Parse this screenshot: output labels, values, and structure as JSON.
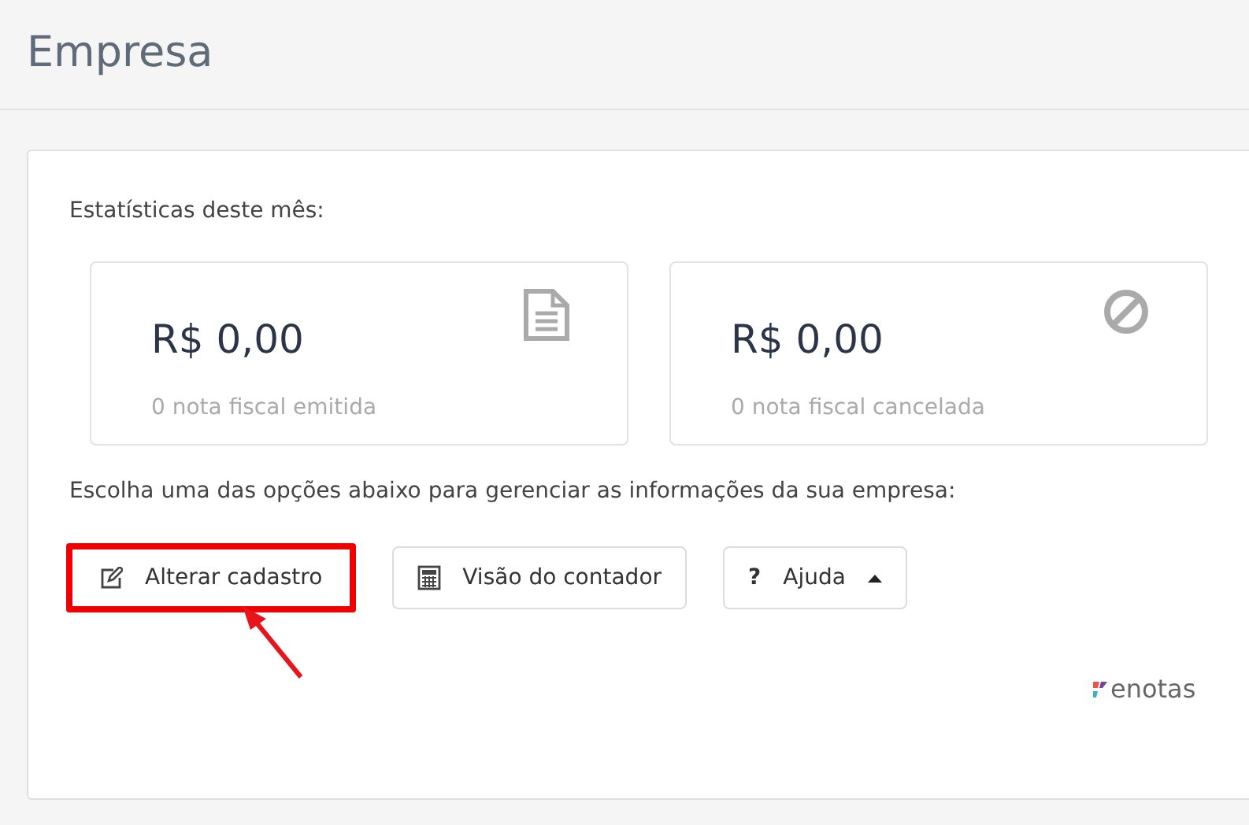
{
  "page": {
    "title": "Empresa"
  },
  "stats_label": "Estatísticas deste mês:",
  "stats": [
    {
      "kind": "document",
      "amount": "R$ 0,00",
      "caption": "0 nota fiscal emitida"
    },
    {
      "kind": "ban",
      "amount": "R$ 0,00",
      "caption": "0 nota fiscal cancelada"
    }
  ],
  "options_label": "Escolha uma das opções abaixo para gerenciar as informações da sua empresa:",
  "actions": [
    {
      "kind": "edit",
      "label": "Alterar cadastro",
      "highlighted": true
    },
    {
      "kind": "calculator",
      "label": "Visão do contador",
      "highlighted": false
    },
    {
      "kind": "help",
      "icon": "?",
      "label": "Ajuda",
      "highlighted": false,
      "caret": true
    }
  ],
  "logo": {
    "text": "enotas"
  }
}
